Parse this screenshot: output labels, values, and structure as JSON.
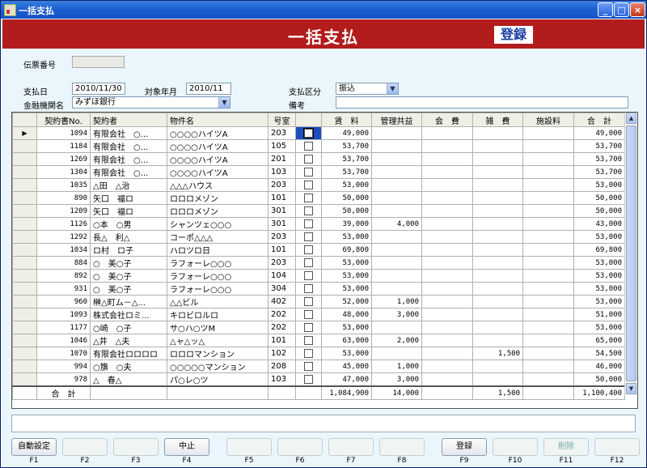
{
  "window": {
    "title": "一括支払"
  },
  "header": {
    "title": "一括支払",
    "register_label": "登録"
  },
  "form": {
    "slip_no_label": "伝票番号",
    "slip_no_value": "",
    "pay_date_label": "支払日",
    "pay_date_value": "2010/11/30",
    "target_month_label": "対象年月",
    "target_month_value": "2010/11",
    "pay_type_label": "支払区分",
    "pay_type_value": "振込",
    "bank_label": "金融機関名",
    "bank_value": "みずほ銀行",
    "note_label": "備考",
    "note_value": ""
  },
  "grid": {
    "columns": [
      "契約書No.",
      "契約者",
      "物件名",
      "号室",
      "",
      "賃　料",
      "管理共益",
      "会　費",
      "雑　費",
      "施設料",
      "合　計"
    ],
    "rows": [
      {
        "no": "1094",
        "tenant": "有限会社　○...",
        "property": "○○○○ハイツA",
        "room": "203",
        "checked": true,
        "rent": "49,000",
        "mgmt": "",
        "fee": "",
        "misc": "",
        "facility": "",
        "total": "49,000"
      },
      {
        "no": "1184",
        "tenant": "有限会社　○...",
        "property": "○○○○ハイツA",
        "room": "105",
        "checked": false,
        "rent": "53,700",
        "mgmt": "",
        "fee": "",
        "misc": "",
        "facility": "",
        "total": "53,700"
      },
      {
        "no": "1269",
        "tenant": "有限会社　○...",
        "property": "○○○○ハイツA",
        "room": "201",
        "checked": false,
        "rent": "53,700",
        "mgmt": "",
        "fee": "",
        "misc": "",
        "facility": "",
        "total": "53,700"
      },
      {
        "no": "1304",
        "tenant": "有限会社　○...",
        "property": "○○○○ハイツA",
        "room": "103",
        "checked": false,
        "rent": "53,700",
        "mgmt": "",
        "fee": "",
        "misc": "",
        "facility": "",
        "total": "53,700"
      },
      {
        "no": "1035",
        "tenant": "△田　△治",
        "property": "△△△ハウス",
        "room": "203",
        "checked": false,
        "rent": "53,000",
        "mgmt": "",
        "fee": "",
        "misc": "",
        "facility": "",
        "total": "53,000"
      },
      {
        "no": "890",
        "tenant": "矢口　福ロ",
        "property": "ロロロメゾン",
        "room": "101",
        "checked": false,
        "rent": "50,000",
        "mgmt": "",
        "fee": "",
        "misc": "",
        "facility": "",
        "total": "50,000"
      },
      {
        "no": "1209",
        "tenant": "矢口　福ロ",
        "property": "ロロロメゾン",
        "room": "301",
        "checked": false,
        "rent": "50,000",
        "mgmt": "",
        "fee": "",
        "misc": "",
        "facility": "",
        "total": "50,000"
      },
      {
        "no": "1126",
        "tenant": "○本　○男",
        "property": "シャンツェ○○○",
        "room": "301",
        "checked": false,
        "rent": "39,000",
        "mgmt": "4,000",
        "fee": "",
        "misc": "",
        "facility": "",
        "total": "43,000"
      },
      {
        "no": "1292",
        "tenant": "長△　利△",
        "property": "コーポ△△△",
        "room": "203",
        "checked": false,
        "rent": "53,000",
        "mgmt": "",
        "fee": "",
        "misc": "",
        "facility": "",
        "total": "53,000"
      },
      {
        "no": "1034",
        "tenant": "ロ村　ロ子",
        "property": "ハロツロ日",
        "room": "101",
        "checked": false,
        "rent": "69,800",
        "mgmt": "",
        "fee": "",
        "misc": "",
        "facility": "",
        "total": "69,800"
      },
      {
        "no": "884",
        "tenant": "○　美○子",
        "property": "ラフォーレ○○○",
        "room": "203",
        "checked": false,
        "rent": "53,000",
        "mgmt": "",
        "fee": "",
        "misc": "",
        "facility": "",
        "total": "53,000"
      },
      {
        "no": "892",
        "tenant": "○　美○子",
        "property": "ラフォーレ○○○",
        "room": "104",
        "checked": false,
        "rent": "53,000",
        "mgmt": "",
        "fee": "",
        "misc": "",
        "facility": "",
        "total": "53,000"
      },
      {
        "no": "931",
        "tenant": "○　美○子",
        "property": "ラフォーレ○○○",
        "room": "304",
        "checked": false,
        "rent": "53,000",
        "mgmt": "",
        "fee": "",
        "misc": "",
        "facility": "",
        "total": "53,000"
      },
      {
        "no": "960",
        "tenant": "榊△町ム－△...",
        "property": "△△ビル",
        "room": "402",
        "checked": false,
        "rent": "52,000",
        "mgmt": "1,000",
        "fee": "",
        "misc": "",
        "facility": "",
        "total": "53,000"
      },
      {
        "no": "1093",
        "tenant": "株式会社ロミ...",
        "property": "キロビロルロ",
        "room": "202",
        "checked": false,
        "rent": "48,000",
        "mgmt": "3,000",
        "fee": "",
        "misc": "",
        "facility": "",
        "total": "51,000"
      },
      {
        "no": "1177",
        "tenant": "○崎　○子",
        "property": "サ○ハ○ツM",
        "room": "202",
        "checked": false,
        "rent": "53,000",
        "mgmt": "",
        "fee": "",
        "misc": "",
        "facility": "",
        "total": "53,000"
      },
      {
        "no": "1046",
        "tenant": "△井　△夫",
        "property": "△ャ△ッ△",
        "room": "101",
        "checked": false,
        "rent": "63,000",
        "mgmt": "2,000",
        "fee": "",
        "misc": "",
        "facility": "",
        "total": "65,000"
      },
      {
        "no": "1070",
        "tenant": "有限会社ロロロロ",
        "property": "ロロロマンション",
        "room": "102",
        "checked": false,
        "rent": "53,000",
        "mgmt": "",
        "fee": "",
        "misc": "1,500",
        "facility": "",
        "total": "54,500"
      },
      {
        "no": "994",
        "tenant": "○籏　○夫",
        "property": "○○○○○マンション",
        "room": "208",
        "checked": false,
        "rent": "45,000",
        "mgmt": "1,000",
        "fee": "",
        "misc": "",
        "facility": "",
        "total": "46,000"
      },
      {
        "no": "978",
        "tenant": "△　春△",
        "property": "パ○レ○ツ",
        "room": "103",
        "checked": false,
        "rent": "47,000",
        "mgmt": "3,000",
        "fee": "",
        "misc": "",
        "facility": "",
        "total": "50,000"
      }
    ],
    "totals": {
      "label": "合　計",
      "rent": "1,084,900",
      "mgmt": "14,000",
      "fee": "",
      "misc": "1,500",
      "facility": "",
      "total": "1,100,400"
    }
  },
  "fkeys": [
    {
      "label": "自動設定",
      "key": "F1",
      "enabled": true
    },
    {
      "label": "",
      "key": "F2",
      "enabled": false
    },
    {
      "label": "",
      "key": "F3",
      "enabled": false
    },
    {
      "label": "中止",
      "key": "F4",
      "enabled": true
    },
    {
      "label": "",
      "key": "F5",
      "enabled": false
    },
    {
      "label": "",
      "key": "F6",
      "enabled": false
    },
    {
      "label": "",
      "key": "F7",
      "enabled": false
    },
    {
      "label": "",
      "key": "F8",
      "enabled": false
    },
    {
      "label": "登録",
      "key": "F9",
      "enabled": true
    },
    {
      "label": "",
      "key": "F10",
      "enabled": false
    },
    {
      "label": "削除",
      "key": "F11",
      "enabled": false
    },
    {
      "label": "",
      "key": "F12",
      "enabled": false
    }
  ]
}
